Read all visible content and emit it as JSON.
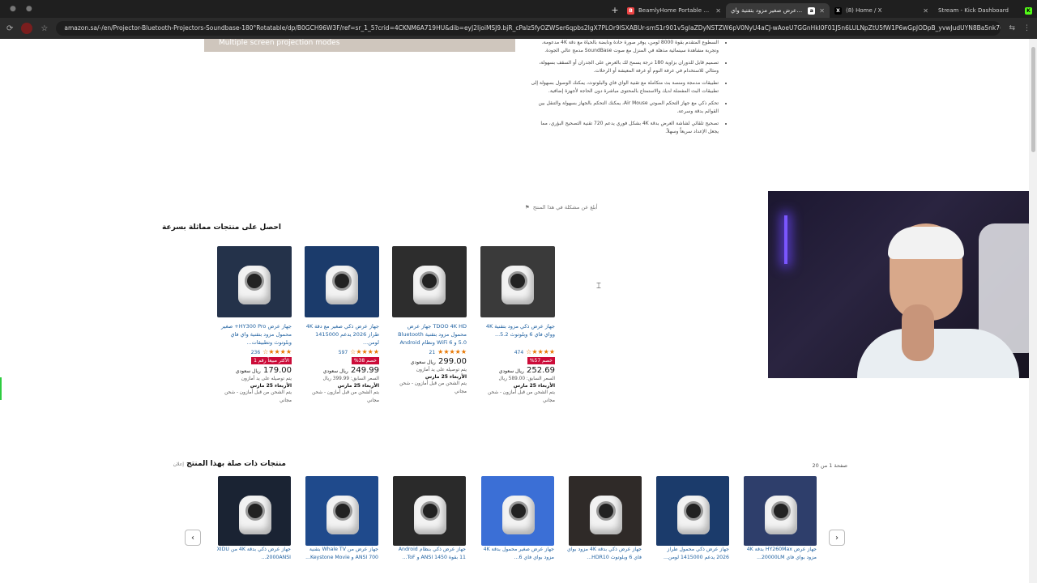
{
  "browser": {
    "tabs": [
      {
        "title": "جهاز عرض صغير مزود بتقنية واي",
        "active": true,
        "fav_color": "#ffffff",
        "fav_glyph": "a"
      },
      {
        "title": "(8) Home / X",
        "active": false,
        "fav_color": "#000000",
        "fav_glyph": "X"
      },
      {
        "title": "Stream - Kick Dashboard",
        "active": false,
        "fav_color": "#53fc18",
        "fav_glyph": "K"
      },
      {
        "title": "BeamlyHome Portable Projector",
        "active": false,
        "fav_color": "#e44",
        "fav_glyph": "B"
      }
    ],
    "url": "amazon.sa/-/en/Projector-Bluetooth-Projectors-Soundbase-180°Rotatable/dp/B0GCH96W3F/ref=sr_1_5?crid=4CKNM6A719HU&dib=eyJ2IjoiMSJ9.bjR_cPalz5fyOZWSer6qpbs2IgX7PLOr9lSXABUr-smS1r901v5glaZDyNSTZW6pV0NyU4aCJ-wAoeU7GGnHkl0F01J5n6LULNpZtU5fW1P6wGpJODpB_yvwJudUYN8Ba5nk7U...",
    "new_tab": "+"
  },
  "hero": {
    "caption": "Multiple screen projection modes"
  },
  "bullets": [
    "السطوع المتقدم بقوة 8000 لومن، يوفر صورة حادة ونابضة بالحياة مع دقة 4K مدعومة، وتجربة مشاهدة سينمائية مذهلة في المنزل مع صوت SoundBase مدمج عالي الجودة.",
    "تصميم قابل للدوران بزاوية 180 درجة يسمح لك بالعرض على الجدران أو السقف بسهولة، ومثالي للاستخدام في غرفة النوم أو غرفة المعيشة أو الرحلات.",
    "تطبيقات مدمجة ومنصة بث متكاملة مع تقنية الواي فاي والبلوتوث، يمكنك الوصول بسهولة إلى تطبيقات البث المفضلة لديك والاستمتاع بالمحتوى مباشرة دون الحاجة لأجهزة إضافية.",
    "تحكم ذكي مع جهاز التحكم الصوتي Air Mouse، يمكنك التحكم بالجهاز بسهولة والتنقل بين القوائم بدقة وسرعة.",
    "تصحيح تلقائي لشاشة العرض بدقة 4K بشكل فوري يدعم 720 تقنية التصحيح البؤري، مما يجعل الإعداد سريعاً وسهلاً."
  ],
  "report": "أبلغ عن مشكلة في هذا المنتج",
  "similar_section": {
    "title": "احصل على منتجات مماثلة بسرعة",
    "items": [
      {
        "title": "جهاز عرض HY300 Pro+ صغير محمول مزود بتقنية واي فاي وبلوتوث وتطبيقات...",
        "stars": "★★★★☆",
        "reviews": "236",
        "badge": "الأكثر مبيعاً رقم 1",
        "price": "179.00",
        "currency": "ريال سعودي",
        "note1": "يتم توصيله على يد أمازون",
        "note2": "الأربعاء 25 مارس",
        "note3": "يتم الشحن من قبل أمازون - شحن مجاني",
        "img": "#24324a"
      },
      {
        "title": "جهاز عرض ذكي صغير مع دقة 4K طراز 2026 يدعم 1415000 لومن...",
        "stars": "★★★★☆",
        "reviews": "597",
        "badge": "خصم 38%",
        "price": "249.99",
        "currency": "ريال سعودي",
        "note1": "السعر السابق: 399.99 ريال",
        "note2": "الأربعاء 25 مارس",
        "note3": "يتم الشحن من قبل أمازون - شحن مجاني",
        "img": "#1b3b6b"
      },
      {
        "title": "TDOO 4K HD جهاز عرض محمول مزود بتقنية Bluetooth 5.0 و WiFi 6 ونظام Android 13.0...",
        "stars": "★★★★★",
        "reviews": "21",
        "badge": "",
        "price": "299.00",
        "currency": "ريال سعودي",
        "note1": "يتم توصيله على يد أمازون",
        "note2": "الأربعاء 25 مارس",
        "note3": "يتم الشحن من قبل أمازون - شحن مجاني",
        "img": "#2d2d2d"
      },
      {
        "title": "جهاز عرض ذكي مزود بتقنية 4K وواي فاي 6 وبلوتوث 5.2...",
        "stars": "★★★★☆",
        "reviews": "474",
        "badge": "خصم 57%",
        "price": "252.69",
        "currency": "ريال سعودي",
        "note1": "السعر السابق: 589.00 ريال",
        "note2": "الأربعاء 25 مارس",
        "note3": "يتم الشحن من قبل أمازون - شحن مجاني",
        "img": "#3a3a3a"
      }
    ]
  },
  "related_section": {
    "title": "منتجات ذات صلة بهذا المنتج",
    "sponsored": "إعلان",
    "pager": "صفحة 1 من 20",
    "prev": "‹",
    "next": "›",
    "items": [
      {
        "title": "جهاز عرض ذكي بدقة 4K من XIDU 2000ANSI...",
        "img": "#1a2333"
      },
      {
        "title": "جهاز عرض من Whale TV بتقنية 700 ANSI و Keystone Movie...",
        "img": "#1f4a8c"
      },
      {
        "title": "جهاز عرض ذكي بنظام Android 11 بقوة 1450 ANSI و ToF...",
        "img": "#2a2a2a"
      },
      {
        "title": "جهاز عرض صغير محمول بدقة 4K مزود بواي فاي 6...",
        "img": "#3b6fd6"
      },
      {
        "title": "جهاز عرض ذكي بدقة 4K مزود بواي فاي 6 وبلوتوث HDR10...",
        "img": "#2f2a28"
      },
      {
        "title": "جهاز عرض ذكي محمول طراز 2026 يدعم 1415000 لومن...",
        "img": "#1b3b6b"
      },
      {
        "title": "جهاز عرض HY260Max بدقة 4K مزود بواي فاي 20000LM...",
        "img": "#2e3e6b"
      }
    ]
  }
}
